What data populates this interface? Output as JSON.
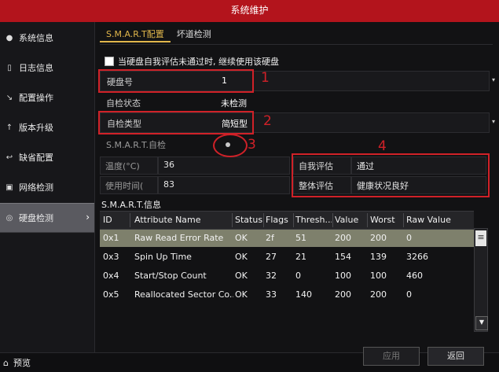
{
  "window": {
    "title": "系统维护"
  },
  "sidebar": {
    "items": [
      {
        "icon": "●",
        "label": "系统信息"
      },
      {
        "icon": "▯",
        "label": "日志信息"
      },
      {
        "icon": "↘",
        "label": "配置操作"
      },
      {
        "icon": "↑",
        "label": "版本升级"
      },
      {
        "icon": "↩",
        "label": "缺省配置"
      },
      {
        "icon": "▣",
        "label": "网络检测"
      },
      {
        "icon": "◎",
        "label": "硬盘检测",
        "chevron": "›"
      }
    ],
    "preview": {
      "icon": "⌂",
      "label": "预览"
    }
  },
  "tabs": [
    {
      "label": "S.M.A.R.T配置"
    },
    {
      "label": "坏道检测"
    }
  ],
  "option": {
    "continue_label": "当硬盘自我评估未通过时, 继续使用该硬盘"
  },
  "form": {
    "disk_no": {
      "label": "硬盘号",
      "value": "1"
    },
    "self_test_status": {
      "label": "自检状态",
      "value": "未检测"
    },
    "self_test_type": {
      "label": "自检类型",
      "value": "简短型"
    },
    "smart_self_test": {
      "label": "S.M.A.R.T.自检"
    }
  },
  "info": {
    "temperature": {
      "label": "温度(°C)",
      "value": "36"
    },
    "usage_time": {
      "label": "使用时间(",
      "value": "83"
    },
    "self_eval": {
      "label": "自我评估",
      "value": "通过"
    },
    "overall_eval": {
      "label": "整体评估",
      "value": "健康状况良好"
    }
  },
  "annotations": {
    "n1": "1",
    "n2": "2",
    "n3": "3",
    "n4": "4"
  },
  "smart_info": {
    "title": "S.M.A.R.T.信息",
    "columns": [
      "ID",
      "Attribute Name",
      "Status",
      "Flags",
      "Thresh...",
      "Value",
      "Worst",
      "Raw Value"
    ],
    "rows": [
      [
        "0x1",
        "Raw Read Error Rate",
        "OK",
        "2f",
        "51",
        "200",
        "200",
        "0"
      ],
      [
        "0x3",
        "Spin Up Time",
        "OK",
        "27",
        "21",
        "154",
        "139",
        "3266"
      ],
      [
        "0x4",
        "Start/Stop Count",
        "OK",
        "32",
        "0",
        "100",
        "100",
        "460"
      ],
      [
        "0x5",
        "Reallocated Sector Co...",
        "OK",
        "33",
        "140",
        "200",
        "200",
        "0"
      ]
    ]
  },
  "buttons": {
    "apply": "应用",
    "back": "返回"
  },
  "colors": {
    "title_bar": "#b3141c",
    "accent": "#e0b64b",
    "annotation_red": "#d02128",
    "selected_row": "#7e806c"
  }
}
